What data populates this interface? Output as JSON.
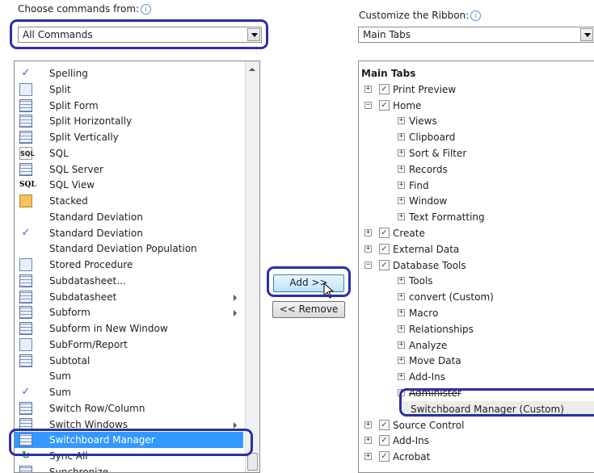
{
  "left": {
    "label": "Choose commands from:",
    "combo_value": "All Commands",
    "commands": [
      {
        "label": "Spelling",
        "icon": "spelling-icon",
        "kind": "check",
        "submenu": false
      },
      {
        "label": "Split",
        "icon": "split-icon",
        "kind": "doc",
        "submenu": false
      },
      {
        "label": "Split Form",
        "icon": "split-form-icon",
        "kind": "grid",
        "submenu": false
      },
      {
        "label": "Split Horizontally",
        "icon": "split-horizontally-icon",
        "kind": "grid",
        "submenu": false
      },
      {
        "label": "Split Vertically",
        "icon": "split-vertically-icon",
        "kind": "grid",
        "submenu": false
      },
      {
        "label": "SQL",
        "icon": "sql-icon",
        "kind": "sql",
        "submenu": false
      },
      {
        "label": "SQL Server",
        "icon": "sql-server-icon",
        "kind": "grid",
        "submenu": false
      },
      {
        "label": "SQL View",
        "icon": "sql-view-icon",
        "kind": "sqlbold",
        "submenu": false
      },
      {
        "label": "Stacked",
        "icon": "stacked-icon",
        "kind": "stack",
        "submenu": false
      },
      {
        "label": "Standard Deviation",
        "icon": "",
        "kind": "none",
        "submenu": false
      },
      {
        "label": "Standard Deviation",
        "icon": "checkmark-icon",
        "kind": "check",
        "submenu": false
      },
      {
        "label": "Standard Deviation Population",
        "icon": "",
        "kind": "none",
        "submenu": false
      },
      {
        "label": "Stored Procedure",
        "icon": "stored-procedure-icon",
        "kind": "doc",
        "submenu": false
      },
      {
        "label": "Subdatasheet...",
        "icon": "subdatasheet-icon",
        "kind": "grid",
        "submenu": false
      },
      {
        "label": "Subdatasheet",
        "icon": "subdatasheet-icon",
        "kind": "grid",
        "submenu": true
      },
      {
        "label": "Subform",
        "icon": "subform-icon",
        "kind": "grid",
        "submenu": true
      },
      {
        "label": "Subform in New Window",
        "icon": "subform-window-icon",
        "kind": "grid",
        "submenu": false
      },
      {
        "label": "SubForm/Report",
        "icon": "subform-report-icon",
        "kind": "doc",
        "submenu": false
      },
      {
        "label": "Subtotal",
        "icon": "subtotal-icon",
        "kind": "grid",
        "submenu": false
      },
      {
        "label": "Sum",
        "icon": "",
        "kind": "none",
        "submenu": false
      },
      {
        "label": "Sum",
        "icon": "checkmark-icon",
        "kind": "check",
        "submenu": false
      },
      {
        "label": "Switch Row/Column",
        "icon": "switch-row-column-icon",
        "kind": "grid",
        "submenu": false
      },
      {
        "label": "Switch Windows",
        "icon": "switch-windows-icon",
        "kind": "grid",
        "submenu": true
      },
      {
        "label": "Switchboard Manager",
        "icon": "switchboard-manager-icon",
        "kind": "grid",
        "submenu": false
      },
      {
        "label": "Sync All",
        "icon": "sync-all-icon",
        "kind": "sync",
        "submenu": false
      },
      {
        "label": "Synchronize",
        "icon": "synchronize-icon",
        "kind": "grid",
        "submenu": false
      }
    ],
    "selected_label": "Switchboard Manager"
  },
  "buttons": {
    "add": "Add >>",
    "remove": "<< Remove"
  },
  "right": {
    "label": "Customize the Ribbon:",
    "combo_value": "Main Tabs",
    "tree": [
      {
        "label": "Main Tabs",
        "level": "header",
        "expander": "",
        "checked": null
      },
      {
        "label": "Print Preview",
        "level": "tab",
        "expander": "+",
        "checked": true
      },
      {
        "label": "Home",
        "level": "tab",
        "expander": "-",
        "checked": true
      },
      {
        "label": "Views",
        "level": "group",
        "expander": "+",
        "checked": null
      },
      {
        "label": "Clipboard",
        "level": "group",
        "expander": "+",
        "checked": null
      },
      {
        "label": "Sort & Filter",
        "level": "group",
        "expander": "+",
        "checked": null
      },
      {
        "label": "Records",
        "level": "group",
        "expander": "+",
        "checked": null
      },
      {
        "label": "Find",
        "level": "group",
        "expander": "+",
        "checked": null
      },
      {
        "label": "Window",
        "level": "group",
        "expander": "+",
        "checked": null
      },
      {
        "label": "Text Formatting",
        "level": "group",
        "expander": "+",
        "checked": null
      },
      {
        "label": "Create",
        "level": "tab",
        "expander": "+",
        "checked": true
      },
      {
        "label": "External Data",
        "level": "tab",
        "expander": "+",
        "checked": true
      },
      {
        "label": "Database Tools",
        "level": "tab",
        "expander": "-",
        "checked": true
      },
      {
        "label": "Tools",
        "level": "group",
        "expander": "+",
        "checked": null
      },
      {
        "label": "convert (Custom)",
        "level": "group",
        "expander": "+",
        "checked": null
      },
      {
        "label": "Macro",
        "level": "group",
        "expander": "+",
        "checked": null
      },
      {
        "label": "Relationships",
        "level": "group",
        "expander": "+",
        "checked": null
      },
      {
        "label": "Analyze",
        "level": "group",
        "expander": "+",
        "checked": null
      },
      {
        "label": "Move Data",
        "level": "group",
        "expander": "+",
        "checked": null
      },
      {
        "label": "Add-Ins",
        "level": "group",
        "expander": "+",
        "checked": null
      },
      {
        "label": "Administer",
        "level": "group",
        "expander": "+",
        "checked": null
      },
      {
        "label": "Switchboard Manager (Custom)",
        "level": "command",
        "expander": "",
        "checked": null
      },
      {
        "label": "Source Control",
        "level": "tab",
        "expander": "+",
        "checked": true
      },
      {
        "label": "Add-Ins",
        "level": "tab",
        "expander": "+",
        "checked": true
      },
      {
        "label": "Acrobat",
        "level": "tab",
        "expander": "+",
        "checked": true
      }
    ]
  },
  "colors": {
    "highlight_ring": "#2b2fa8",
    "selection": "#3399ff"
  }
}
